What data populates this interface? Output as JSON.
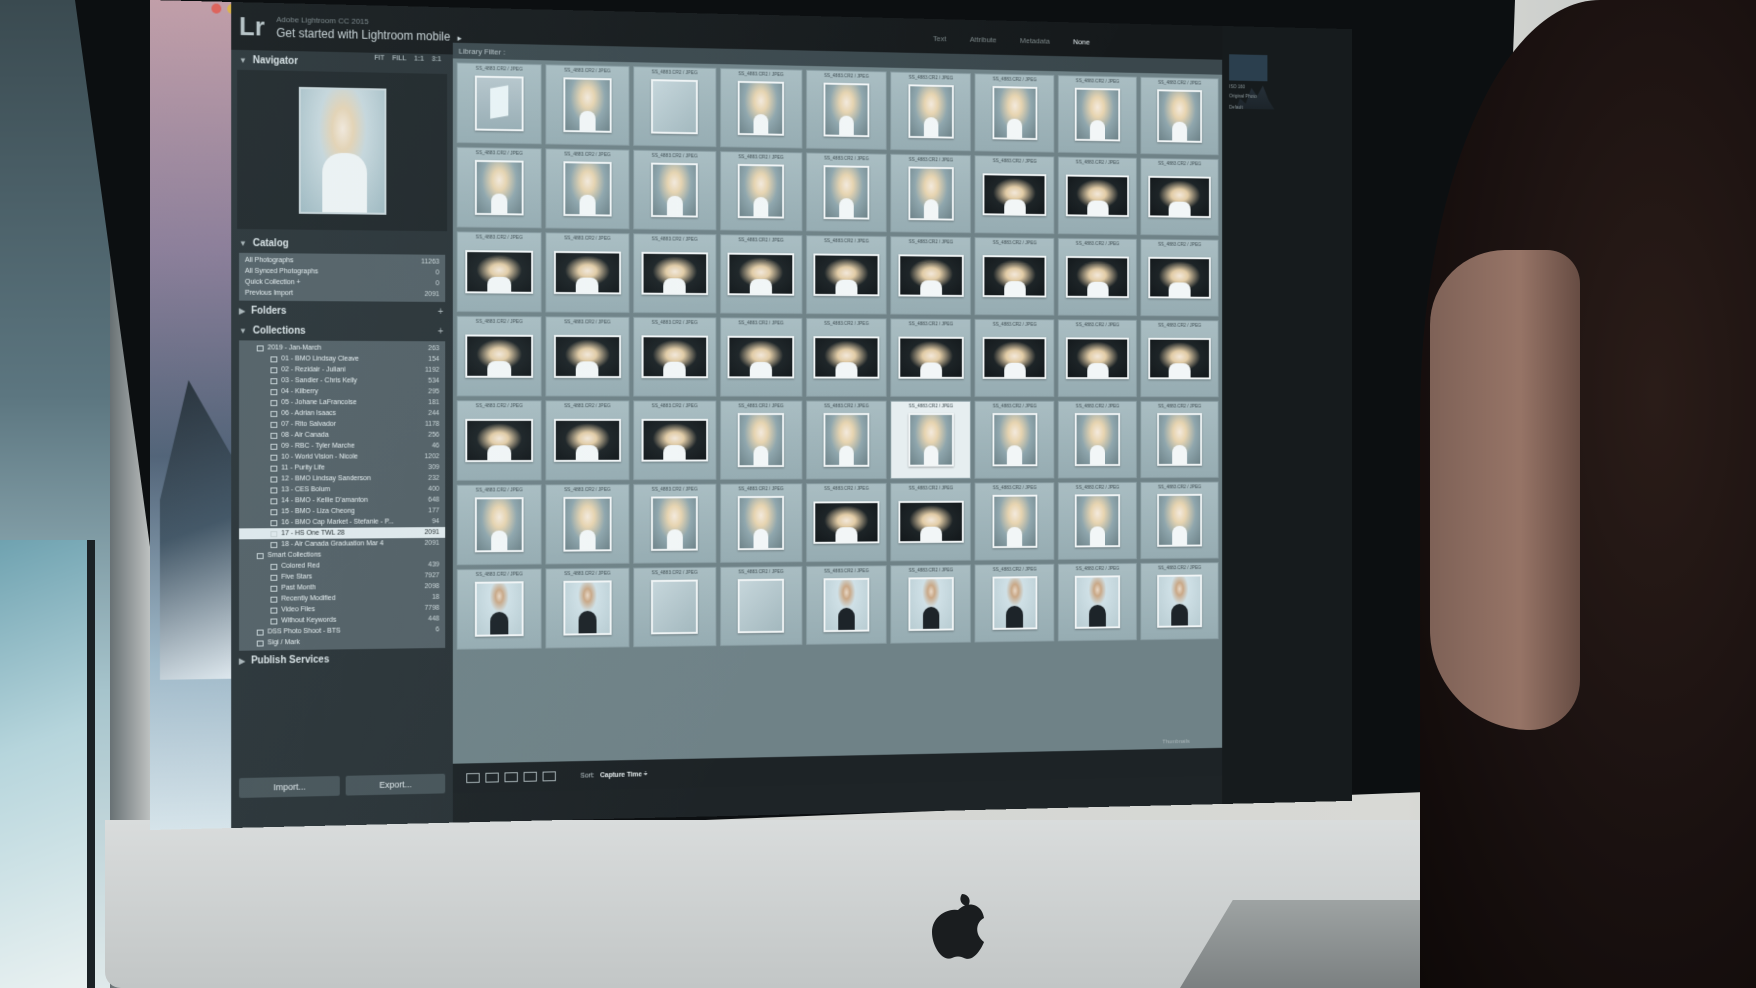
{
  "app": {
    "logo": "Lr",
    "identity_small": "Adobe Lightroom CC 2015",
    "identity_big": "Get started with Lightroom mobile",
    "identity_arrow": "▸"
  },
  "modules": [
    "Text",
    "Attribute",
    "Metadata",
    "None"
  ],
  "navigator": {
    "title": "Navigator",
    "options": [
      "FIT",
      "FILL",
      "1:1",
      "3:1"
    ]
  },
  "catalog": {
    "title": "Catalog",
    "items": [
      {
        "name": "All Photographs",
        "count": "11263"
      },
      {
        "name": "All Synced Photographs",
        "count": "0"
      },
      {
        "name": "Quick Collection +",
        "count": "0"
      },
      {
        "name": "Previous Import",
        "count": "2091"
      }
    ]
  },
  "folders": {
    "title": "Folders"
  },
  "collections": {
    "title": "Collections",
    "group": {
      "name": "2019 - Jan-March",
      "count": "263"
    },
    "items": [
      {
        "name": "01 - BMO Lindsay Cleave",
        "count": "154"
      },
      {
        "name": "02 - Rezidair - Juliani",
        "count": "1192"
      },
      {
        "name": "03 - Sandler - Chris Kelly",
        "count": "534"
      },
      {
        "name": "04 - Kilberry",
        "count": "295"
      },
      {
        "name": "05 - Johane LaFrancoise",
        "count": "181"
      },
      {
        "name": "06 - Adrian Isaacs",
        "count": "244"
      },
      {
        "name": "07 - Rito Salvador",
        "count": "1178"
      },
      {
        "name": "08 - Air Canada",
        "count": "256"
      },
      {
        "name": "09 - RBC - Tyler Marche",
        "count": "46"
      },
      {
        "name": "10 - World Vision - Nicole",
        "count": "1202"
      },
      {
        "name": "11 - Purity Life",
        "count": "309"
      },
      {
        "name": "12 - BMO Lindsay Sanderson",
        "count": "232"
      },
      {
        "name": "13 - CES Bolum",
        "count": "400"
      },
      {
        "name": "14 - BMO - Kellie D'amanton",
        "count": "648"
      },
      {
        "name": "15 - BMO - Liza Cheong",
        "count": "177"
      },
      {
        "name": "16 - BMO Cap Market - Stefanie - P...",
        "count": "94"
      },
      {
        "name": "17 - HS One TWL 28",
        "count": "2091",
        "selected": true
      },
      {
        "name": "18 - Air Canada Graduation Mar 4",
        "count": "2091"
      }
    ],
    "smart_group": {
      "name": "Smart Collections",
      "count": ""
    },
    "smart_items": [
      {
        "name": "Colored Red",
        "count": "439"
      },
      {
        "name": "Five Stars",
        "count": "7927"
      },
      {
        "name": "Past Month",
        "count": "2098"
      },
      {
        "name": "Recently Modified",
        "count": "18"
      },
      {
        "name": "Video Files",
        "count": "7798"
      },
      {
        "name": "Without Keywords",
        "count": "448"
      }
    ],
    "extra_items": [
      {
        "name": "DSS Photo Shoot - BTS",
        "count": "6"
      },
      {
        "name": "Sigi / Mark",
        "count": ""
      }
    ]
  },
  "publish": {
    "title": "Publish Services"
  },
  "buttons": {
    "import": "Import...",
    "export": "Export..."
  },
  "grid": {
    "filter_label": "Library Filter :",
    "file_label": "SS_4883.CR2 / JPEG",
    "rows": [
      [
        "box",
        "std",
        "blank",
        "std",
        "std",
        "std",
        "std",
        "std",
        "std"
      ],
      [
        "std",
        "std",
        "std",
        "std",
        "std",
        "std",
        "wide",
        "wide",
        "wide"
      ],
      [
        "wide",
        "wide",
        "wide",
        "wide",
        "wide",
        "wide",
        "wide",
        "wide",
        "wide"
      ],
      [
        "wide",
        "wide",
        "wide",
        "wide",
        "wide",
        "wide",
        "wide",
        "wide",
        "wide"
      ],
      [
        "wide",
        "wide",
        "wide",
        "std",
        "std",
        "hl",
        "std",
        "std",
        "std"
      ],
      [
        "std",
        "std",
        "std",
        "std",
        "wide",
        "wide",
        "std",
        "std",
        "std"
      ],
      [
        "man",
        "man",
        "blank",
        "blank",
        "man",
        "man",
        "man",
        "man",
        "man"
      ]
    ]
  },
  "toolbar": {
    "sort_label": "Sort:",
    "sort_value": "Capture Time ÷"
  },
  "right_panel": {
    "label1": "ISO 160",
    "label2": "Original Photo",
    "label3": "Default",
    "thumbnails": "Thumbnails"
  },
  "colors": {
    "accent": "#dfe9ec",
    "panel": "#2a3337",
    "grid_bg": "#6f8287"
  }
}
